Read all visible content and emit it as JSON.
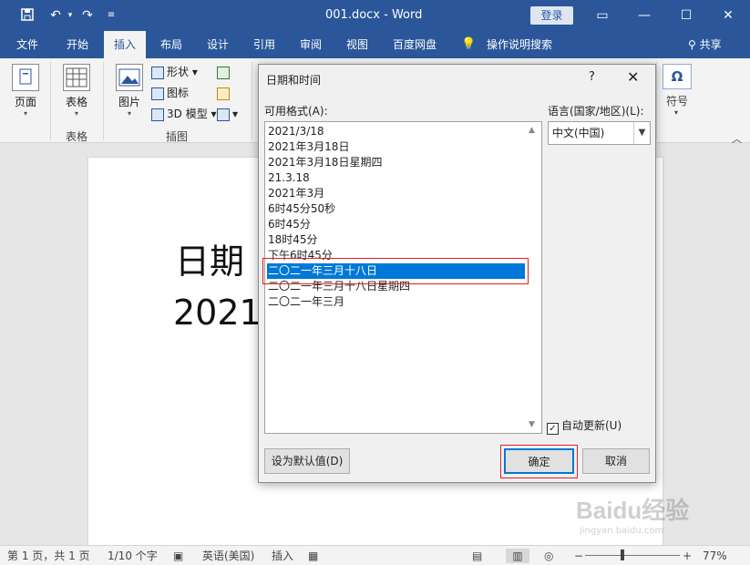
{
  "titlebar": {
    "doc_title": "001.docx  -  Word",
    "login_label": "登录",
    "icons": [
      "save-icon",
      "undo-icon",
      "redo-icon",
      "customize-icon",
      "ribbon-display-icon",
      "minimize-icon",
      "maximize-icon",
      "close-icon"
    ]
  },
  "tabs": [
    {
      "label": "文件"
    },
    {
      "label": "开始"
    },
    {
      "label": "插入"
    },
    {
      "label": "布局"
    },
    {
      "label": "设计"
    },
    {
      "label": "引用"
    },
    {
      "label": "审阅"
    },
    {
      "label": "视图"
    },
    {
      "label": "百度网盘"
    },
    {
      "label": "操作说明搜索"
    }
  ],
  "share_label": "共享",
  "ribbon": {
    "page_label": "页面",
    "table_label": "表格",
    "table_group": "表格",
    "picture_label": "图片",
    "shapes_label": "形状",
    "icons_label": "图标",
    "model3d_label": "3D 模型",
    "illustrations_group": "插图",
    "symbol_label": "符号"
  },
  "document": {
    "line1": "日期",
    "line2": "2021"
  },
  "dialog": {
    "title": "日期和时间",
    "help": "?",
    "close": "✕",
    "formats_label": "可用格式(A):",
    "language_label": "语言(国家/地区)(L):",
    "language_value": "中文(中国)",
    "formats": [
      "2021/3/18",
      "2021年3月18日",
      "2021年3月18日星期四",
      "21.3.18",
      "2021年3月",
      "6时45分50秒",
      "6时45分",
      "18时45分",
      "下午6时45分",
      "二〇二一年三月十八日",
      "二〇二一年三月十八日星期四",
      "二〇二一年三月"
    ],
    "selected_index": 9,
    "auto_update_label": "自动更新(U)",
    "auto_update_checked": true,
    "set_default_label": "设为默认值(D)",
    "ok_label": "确定",
    "cancel_label": "取消"
  },
  "statusbar": {
    "page": "第 1 页，共 1 页",
    "words": "1/10 个字",
    "language": "英语(美国)",
    "mode": "插入",
    "zoom": "77%"
  },
  "watermark": "Baidu经验",
  "watermark_url": "jingyan.baidu.com"
}
